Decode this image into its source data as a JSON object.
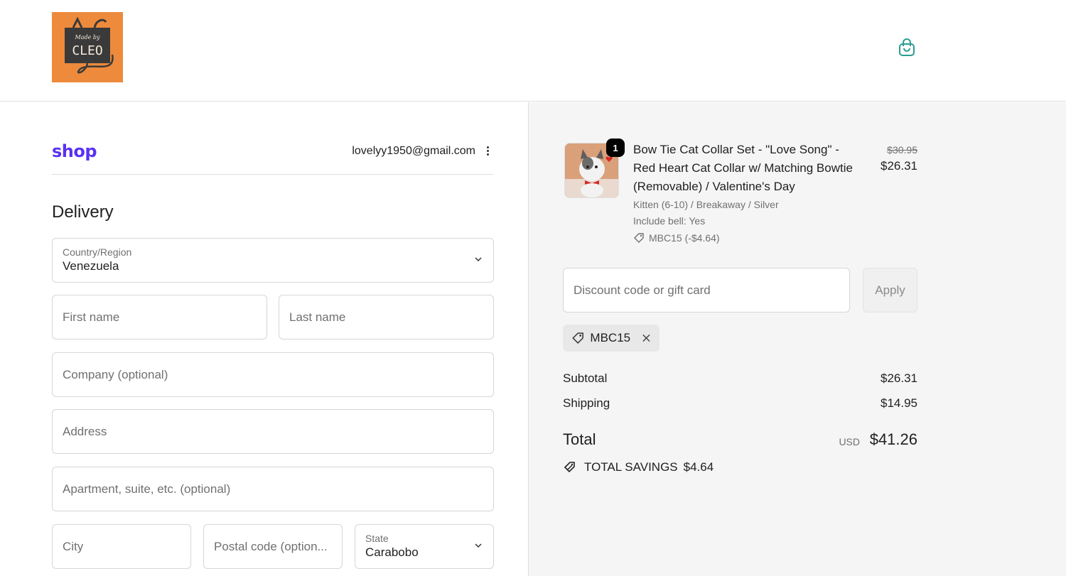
{
  "header": {
    "logo_text_top": "Made by",
    "logo_text_bottom": "CLEO"
  },
  "account": {
    "shop_logo": "shop",
    "email": "lovelyy1950@gmail.com"
  },
  "delivery": {
    "title": "Delivery",
    "country_label": "Country/Region",
    "country_value": "Venezuela",
    "first_name_ph": "First name",
    "last_name_ph": "Last name",
    "company_ph": "Company (optional)",
    "address_ph": "Address",
    "apartment_ph": "Apartment, suite, etc. (optional)",
    "city_ph": "City",
    "postal_ph": "Postal code (option...",
    "state_label": "State",
    "state_value": "Carabobo"
  },
  "order": {
    "quantity": "1",
    "product_title": "Bow Tie Cat Collar Set - \"Love Song\" - Red Heart Cat Collar w/ Matching Bowtie (Removable) / Valentine's Day",
    "variant": "Kitten (6-10) / Breakaway / Silver",
    "option": "Include bell: Yes",
    "line_discount": "MBC15 (-$4.64)",
    "original_price": "$30.95",
    "price": "$26.31",
    "discount_placeholder": "Discount code or gift card",
    "apply_label": "Apply",
    "applied_code": "MBC15",
    "subtotal_label": "Subtotal",
    "subtotal_value": "$26.31",
    "shipping_label": "Shipping",
    "shipping_value": "$14.95",
    "total_label": "Total",
    "currency": "USD",
    "total_value": "$41.26",
    "savings_label": "TOTAL SAVINGS",
    "savings_value": "$4.64"
  },
  "colors": {
    "shop_brand": "#5a31f4",
    "cart_icon": "#2a9d8f",
    "logo_bg": "#ed8a3c"
  }
}
